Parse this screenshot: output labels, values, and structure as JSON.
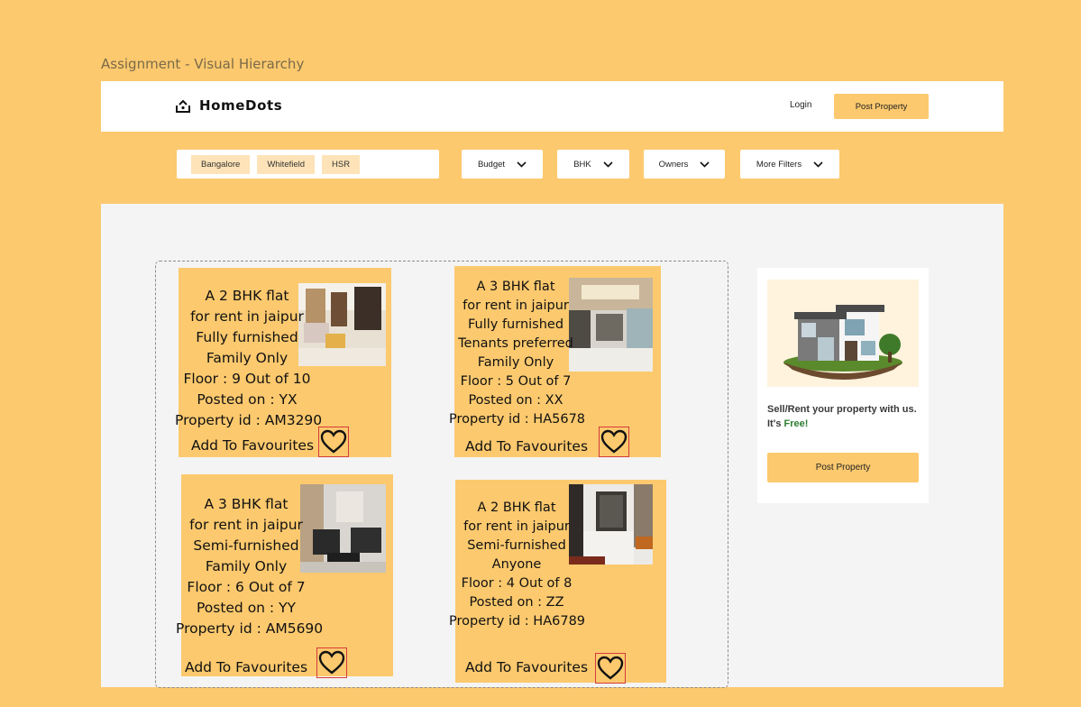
{
  "page_label": "Assignment - Visual Hierarchy",
  "header": {
    "brand": "HomeDots",
    "login_label": "Login",
    "post_property_label": "Post Property"
  },
  "search": {
    "chips": [
      "Bangalore",
      "Whitefield",
      "HSR"
    ]
  },
  "filters": {
    "budget": "Budget",
    "bhk": "BHK",
    "owners": "Owners",
    "more": "More Filters"
  },
  "listings": [
    {
      "lines": [
        "A 2 BHK flat",
        "for rent in jaipur",
        "Fully furnished",
        "Family Only",
        "Floor : 9 Out of 10",
        "Posted on : YX",
        "Property id : AM3290"
      ],
      "favourite_label": "Add To Favourites"
    },
    {
      "lines": [
        "A 3 BHK flat",
        "for rent in jaipur",
        "Fully furnished",
        "Tenants preferred",
        "Family Only",
        "Floor : 5 Out of 7",
        "Posted on : XX",
        "Property id : HA5678"
      ],
      "favourite_label": "Add To Favourites"
    },
    {
      "lines": [
        "A 3 BHK flat",
        "for rent in jaipur",
        "Semi-furnished",
        "Family Only",
        "Floor : 6 Out of 7",
        "Posted on : YY",
        "Property id : AM5690"
      ],
      "favourite_label": "Add To Favourites"
    },
    {
      "lines": [
        "A 2 BHK flat",
        "for rent in jaipur",
        "Semi-furnished",
        "Anyone",
        "Floor : 4 Out of 8",
        "Posted on : ZZ",
        "Property id : HA6789"
      ],
      "favourite_label": "Add To Favourites"
    }
  ],
  "promo": {
    "text": "Sell/Rent your property with us. It's",
    "highlight": "Free!",
    "button_label": "Post Property"
  },
  "colors": {
    "background": "#FCC96E",
    "card": "#FCC96E",
    "free_highlight": "#2E7D32",
    "heart_border": "#d43b3b"
  },
  "icons": [
    "home-logo-icon",
    "chevron-down-icon",
    "heart-icon"
  ]
}
